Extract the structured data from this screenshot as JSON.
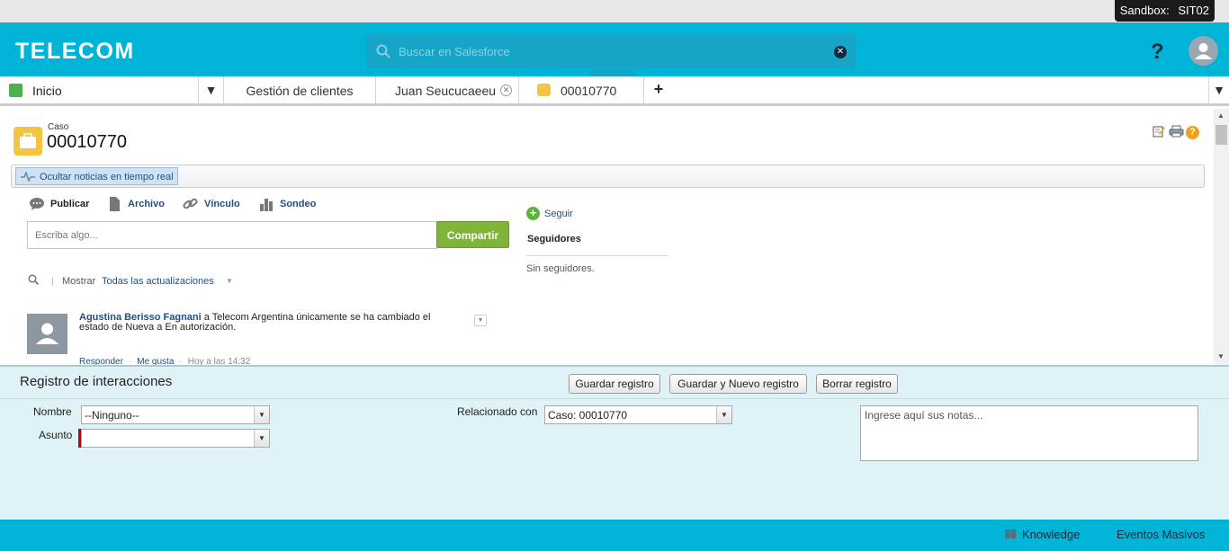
{
  "sandbox": {
    "label": "Sandbox:",
    "name": "SIT02"
  },
  "header": {
    "logo": "TELECOM",
    "search_placeholder": "Buscar en Salesforce",
    "help_label": "?"
  },
  "tabs": {
    "home": "Inicio",
    "clientes": "Gestión de clientes",
    "juan": "Juan Seucucaeeu",
    "case": "00010770",
    "add": "+"
  },
  "record": {
    "object_label": "Caso",
    "number": "00010770",
    "news_toggle": "Ocultar noticias en tiempo real"
  },
  "publisher": {
    "tabs": [
      "Publicar",
      "Archivo",
      "Vínculo",
      "Sondeo"
    ],
    "input_placeholder": "Escriba algo...",
    "share_label": "Compartir"
  },
  "feed_filter": {
    "label": "Mostrar",
    "value": "Todas las actualizaciones"
  },
  "feed_item": {
    "author": "Agustina Berisso Fagnani",
    "text": " a Telecom Argentina únicamente se ha cambiado el estado de Nueva a En autorización.",
    "reply": "Responder",
    "like": "Me gusta",
    "time": "Hoy a las 14:32"
  },
  "followers": {
    "follow_label": "Seguir",
    "title": "Seguidores",
    "empty": "Sin seguidores."
  },
  "interaction_log": {
    "title": "Registro de interacciones",
    "save_label": "Guardar registro",
    "save_new_label": "Guardar y Nuevo registro",
    "clear_label": "Borrar registro",
    "name_label": "Nombre",
    "name_value": "--Ninguno--",
    "subject_label": "Asunto",
    "subject_value": "",
    "related_label": "Relacionado con",
    "related_value": "Caso: 00010770",
    "notes_placeholder": "Ingrese aquí sus notas..."
  },
  "footer": {
    "knowledge": "Knowledge",
    "events": "Eventos Masivos"
  },
  "colors": {
    "brand": "#00b4d8",
    "share_button": "#7fb33a",
    "case_icon": "#f4c542",
    "link": "#1f4f82"
  }
}
